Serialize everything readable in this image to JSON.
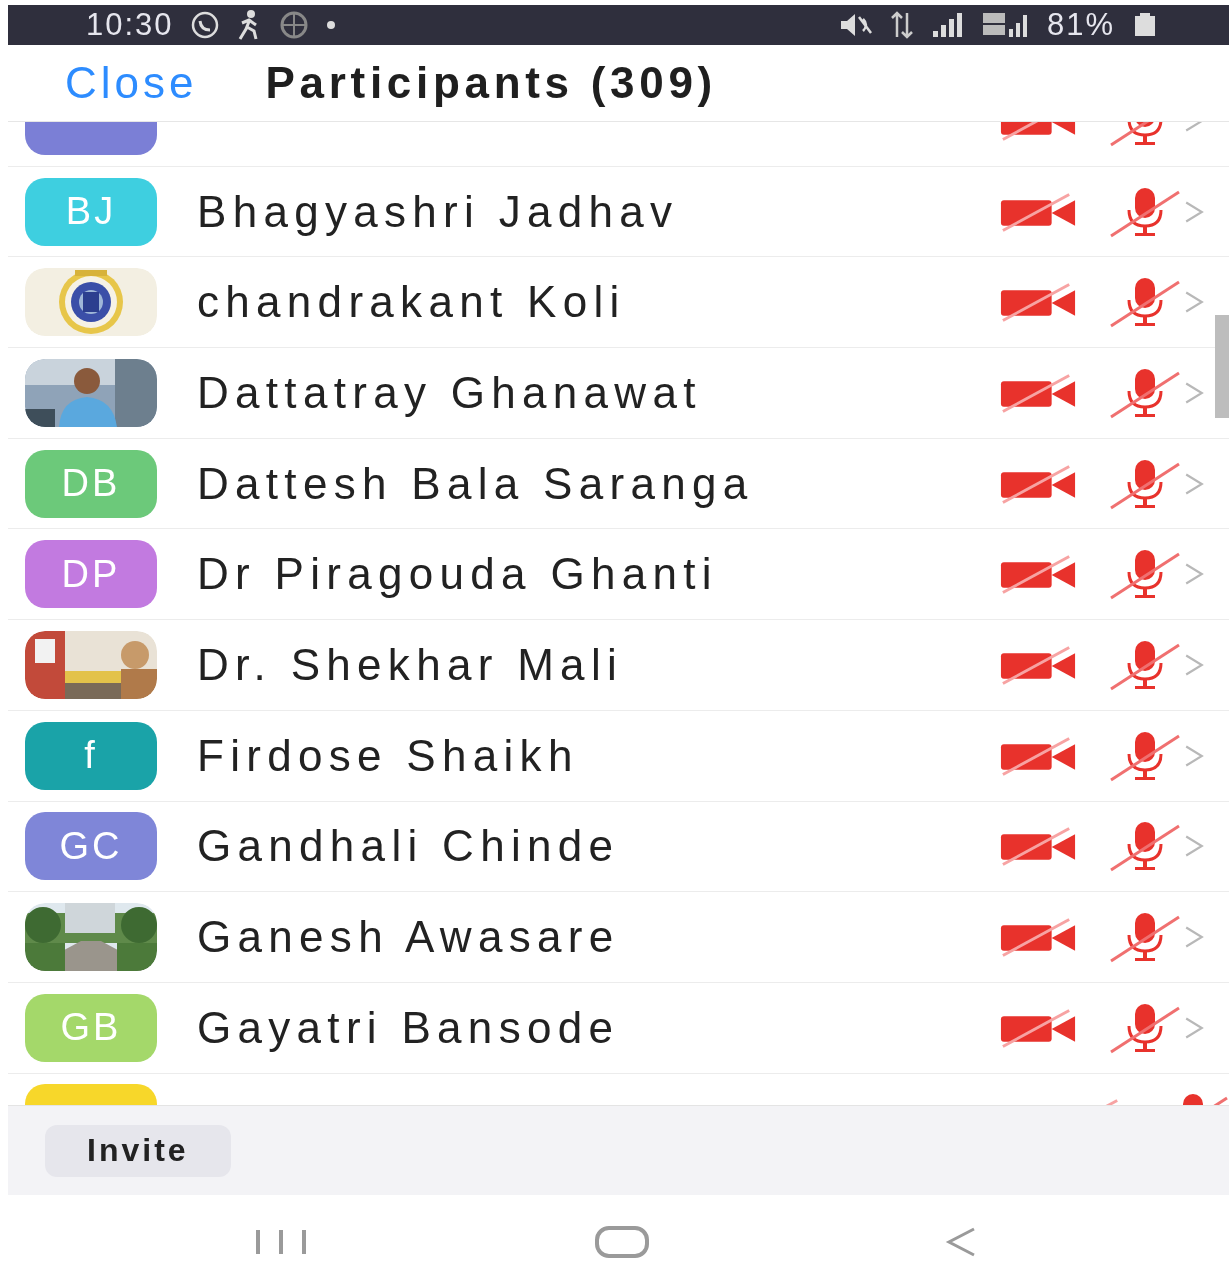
{
  "status_bar": {
    "time": "10:30",
    "battery": "81%"
  },
  "header": {
    "close": "Close",
    "title": "Participants (309)"
  },
  "participants": [
    {
      "avatar": {
        "kind": "initials",
        "color": "#7b7fd6"
      },
      "video_muted": true,
      "audio_muted": true
    },
    {
      "name": "Bhagyashri Jadhav",
      "avatar": {
        "kind": "initials",
        "initials": "BJ",
        "color": "#3ecfe0"
      },
      "video_muted": true,
      "audio_muted": true
    },
    {
      "name": "chandrakant Koli",
      "video_muted": true,
      "audio_muted": true
    },
    {
      "name": "Dattatray Ghanawat",
      "video_muted": true,
      "audio_muted": true
    },
    {
      "name": "Dattesh Bala Saranga",
      "avatar": {
        "kind": "initials",
        "initials": "DB",
        "color": "#6cc97a"
      },
      "video_muted": true,
      "audio_muted": true
    },
    {
      "name": "Dr Piragouda Ghanti",
      "avatar": {
        "kind": "initials",
        "initials": "DP",
        "color": "#c27ae0"
      },
      "video_muted": true,
      "audio_muted": true
    },
    {
      "name": "Dr. Shekhar Mali",
      "video_muted": true,
      "audio_muted": true
    },
    {
      "name": "Firdose Shaikh",
      "avatar": {
        "kind": "initials",
        "initials": "f",
        "color": "#1aa3a8"
      },
      "video_muted": true,
      "audio_muted": true
    },
    {
      "name": "Gandhali Chinde",
      "avatar": {
        "kind": "initials",
        "initials": "GC",
        "color": "#7f86d8"
      },
      "video_muted": true,
      "audio_muted": true
    },
    {
      "name": "Ganesh Awasare",
      "video_muted": true,
      "audio_muted": true
    },
    {
      "name": "Gayatri Bansode",
      "avatar": {
        "kind": "initials",
        "initials": "GB",
        "color": "#a4d86a"
      },
      "video_muted": true,
      "audio_muted": true
    },
    {
      "avatar": {
        "kind": "initials",
        "color": "#f7d72a"
      },
      "video_muted": true,
      "audio_muted": true
    }
  ],
  "invite": "Invite"
}
